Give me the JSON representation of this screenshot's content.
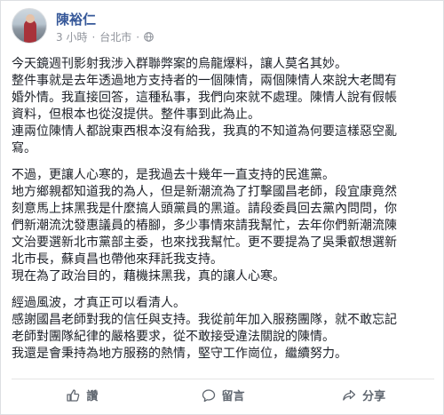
{
  "post": {
    "author": "陳裕仁",
    "time": "3 小時",
    "separator": "·",
    "location": "台北市",
    "privacy_icon": "globe-icon",
    "paragraphs": [
      [
        "今天鏡週刊影射我涉入群聯弊案的烏龍爆料，讓人莫名其妙。",
        "整件事就是去年透過地方支持者的一個陳情，兩個陳情人來說大老闆有",
        "婚外情。我直接回答，這種私事，我們向來就不處理。陳情人說有假帳",
        "資料，但根本也從沒提供。整件事到此為止。",
        "連兩位陳情人都說東西根本沒有給我，我真的不知道為何要這樣惡空亂",
        "寫。"
      ],
      [
        "不過，更讓人心寒的，是我過去十幾年一直支持的民進黨。",
        "地方鄉親都知道我的為人，但是新潮流為了打擊國昌老師，段宜康竟然",
        "刻意馬上抹黑我是什麼搞人頭黨員的黑道。請段委員回去黨內問問，你",
        "們新潮流沈發惠議員的樁腳，多少事情來請我幫忙，去年你們新潮流陳",
        "文治要選新北市黨部主委，也來找我幫忙。更不要提為了吳秉叡想選新",
        "北市長，蘇貞昌也帶他來拜託我支持。",
        "現在為了政治目的，藉機抹黑我，真的讓人心寒。"
      ],
      [
        "經過風波，才真正可以看清人。",
        "感謝國昌老師對我的信任與支持。我從前年加入服務團隊，就不敢忘記",
        "老師對團隊紀律的嚴格要求，從不敢接受違法關說的陳情。",
        "我還是會秉持為地方服務的熱情，堅守工作崗位，繼續努力。"
      ]
    ]
  },
  "actions": {
    "like": "讚",
    "comment": "留言",
    "share": "分享"
  },
  "colors": {
    "author_link": "#365899",
    "meta_text": "#90949c",
    "action_text": "#606770"
  }
}
